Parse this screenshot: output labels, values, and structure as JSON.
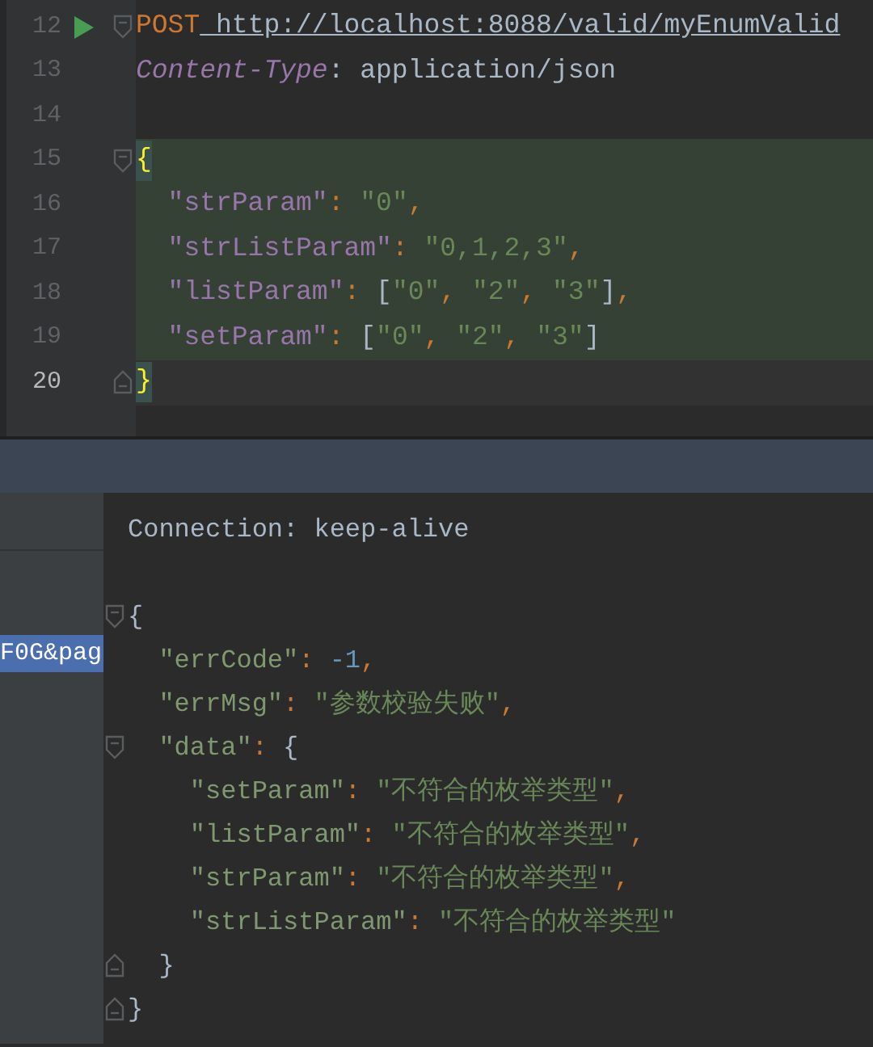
{
  "request_editor": {
    "lines": [
      {
        "number": "12",
        "current": false,
        "highlighted": false,
        "run": true,
        "fold_open": true,
        "fold_close": false,
        "tokens": [
          {
            "kind": "method",
            "text": "POST"
          },
          {
            "kind": "url",
            "text": " http://localhost:8088/valid/myEnumValid"
          }
        ]
      },
      {
        "number": "13",
        "current": false,
        "highlighted": false,
        "run": false,
        "fold_open": false,
        "fold_close": false,
        "tokens": [
          {
            "kind": "header",
            "text": "Content-Type"
          },
          {
            "kind": "plain",
            "text": ": application/json"
          }
        ]
      },
      {
        "number": "14",
        "current": false,
        "highlighted": false,
        "run": false,
        "fold_open": false,
        "fold_close": false
      },
      {
        "number": "15",
        "current": false,
        "highlighted": true,
        "run": false,
        "fold_open": true,
        "fold_close": false,
        "tokens": [
          {
            "kind": "brace-match",
            "text": "{"
          }
        ]
      },
      {
        "number": "16",
        "current": false,
        "highlighted": true,
        "run": false,
        "fold_open": false,
        "fold_close": false,
        "tokens": [
          {
            "kind": "key",
            "text": "  \"strParam\""
          },
          {
            "kind": "punct",
            "text": ": "
          },
          {
            "kind": "string",
            "text": "\"0\""
          },
          {
            "kind": "punct",
            "text": ","
          }
        ]
      },
      {
        "number": "17",
        "current": false,
        "highlighted": true,
        "run": false,
        "fold_open": false,
        "fold_close": false,
        "tokens": [
          {
            "kind": "key",
            "text": "  \"strListParam\""
          },
          {
            "kind": "punct",
            "text": ": "
          },
          {
            "kind": "string",
            "text": "\"0,1,2,3\""
          },
          {
            "kind": "punct",
            "text": ","
          }
        ]
      },
      {
        "number": "18",
        "current": false,
        "highlighted": true,
        "run": false,
        "fold_open": false,
        "fold_close": false,
        "tokens": [
          {
            "kind": "key",
            "text": "  \"listParam\""
          },
          {
            "kind": "punct",
            "text": ": "
          },
          {
            "kind": "plain",
            "text": "["
          },
          {
            "kind": "string",
            "text": "\"0\""
          },
          {
            "kind": "punct",
            "text": ", "
          },
          {
            "kind": "string",
            "text": "\"2\""
          },
          {
            "kind": "punct",
            "text": ", "
          },
          {
            "kind": "string",
            "text": "\"3\""
          },
          {
            "kind": "plain",
            "text": "]"
          },
          {
            "kind": "punct",
            "text": ","
          }
        ]
      },
      {
        "number": "19",
        "current": false,
        "highlighted": true,
        "run": false,
        "fold_open": false,
        "fold_close": false,
        "tokens": [
          {
            "kind": "key",
            "text": "  \"setParam\""
          },
          {
            "kind": "punct",
            "text": ": "
          },
          {
            "kind": "plain",
            "text": "["
          },
          {
            "kind": "string",
            "text": "\"0\""
          },
          {
            "kind": "punct",
            "text": ", "
          },
          {
            "kind": "string",
            "text": "\"2\""
          },
          {
            "kind": "punct",
            "text": ", "
          },
          {
            "kind": "string",
            "text": "\"3\""
          },
          {
            "kind": "plain",
            "text": "]"
          }
        ]
      },
      {
        "number": "20",
        "current": true,
        "highlighted": false,
        "run": false,
        "fold_open": false,
        "fold_close": true,
        "tokens": [
          {
            "kind": "brace-match",
            "text": "}"
          }
        ]
      }
    ]
  },
  "sidebar": {
    "items": [
      {
        "label": "F0G&pag",
        "selected": true
      }
    ]
  },
  "response": {
    "lines": [
      {
        "fold_open": false,
        "fold_close": false,
        "tokens": [
          {
            "kind": "plain",
            "text": "Connection: keep-alive"
          }
        ]
      },
      {
        "fold_open": false,
        "fold_close": false
      },
      {
        "fold_open": true,
        "fold_close": false,
        "tokens": [
          {
            "kind": "plain",
            "text": "{"
          }
        ]
      },
      {
        "fold_open": false,
        "fold_close": false,
        "tokens": [
          {
            "kind": "name",
            "text": "  \"errCode\""
          },
          {
            "kind": "punct",
            "text": ": "
          },
          {
            "kind": "number",
            "text": "-1"
          },
          {
            "kind": "punct",
            "text": ","
          }
        ]
      },
      {
        "fold_open": false,
        "fold_close": false,
        "tokens": [
          {
            "kind": "name",
            "text": "  \"errMsg\""
          },
          {
            "kind": "punct",
            "text": ": "
          },
          {
            "kind": "string",
            "text": "\"参数校验失败\""
          },
          {
            "kind": "punct",
            "text": ","
          }
        ]
      },
      {
        "fold_open": true,
        "fold_close": false,
        "tokens": [
          {
            "kind": "name",
            "text": "  \"data\""
          },
          {
            "kind": "punct",
            "text": ": "
          },
          {
            "kind": "plain",
            "text": "{"
          }
        ]
      },
      {
        "fold_open": false,
        "fold_close": false,
        "tokens": [
          {
            "kind": "name",
            "text": "    \"setParam\""
          },
          {
            "kind": "punct",
            "text": ": "
          },
          {
            "kind": "string",
            "text": "\"不符合的枚举类型\""
          },
          {
            "kind": "punct",
            "text": ","
          }
        ]
      },
      {
        "fold_open": false,
        "fold_close": false,
        "tokens": [
          {
            "kind": "name",
            "text": "    \"listParam\""
          },
          {
            "kind": "punct",
            "text": ": "
          },
          {
            "kind": "string",
            "text": "\"不符合的枚举类型\""
          },
          {
            "kind": "punct",
            "text": ","
          }
        ]
      },
      {
        "fold_open": false,
        "fold_close": false,
        "tokens": [
          {
            "kind": "name",
            "text": "    \"strParam\""
          },
          {
            "kind": "punct",
            "text": ": "
          },
          {
            "kind": "string",
            "text": "\"不符合的枚举类型\""
          },
          {
            "kind": "punct",
            "text": ","
          }
        ]
      },
      {
        "fold_open": false,
        "fold_close": false,
        "tokens": [
          {
            "kind": "name",
            "text": "    \"strListParam\""
          },
          {
            "kind": "punct",
            "text": ": "
          },
          {
            "kind": "string",
            "text": "\"不符合的枚举类型\""
          }
        ]
      },
      {
        "fold_open": false,
        "fold_close": true,
        "tokens": [
          {
            "kind": "plain",
            "text": "  }"
          }
        ]
      },
      {
        "fold_open": false,
        "fold_close": true,
        "tokens": [
          {
            "kind": "plain",
            "text": "}"
          }
        ]
      }
    ]
  }
}
